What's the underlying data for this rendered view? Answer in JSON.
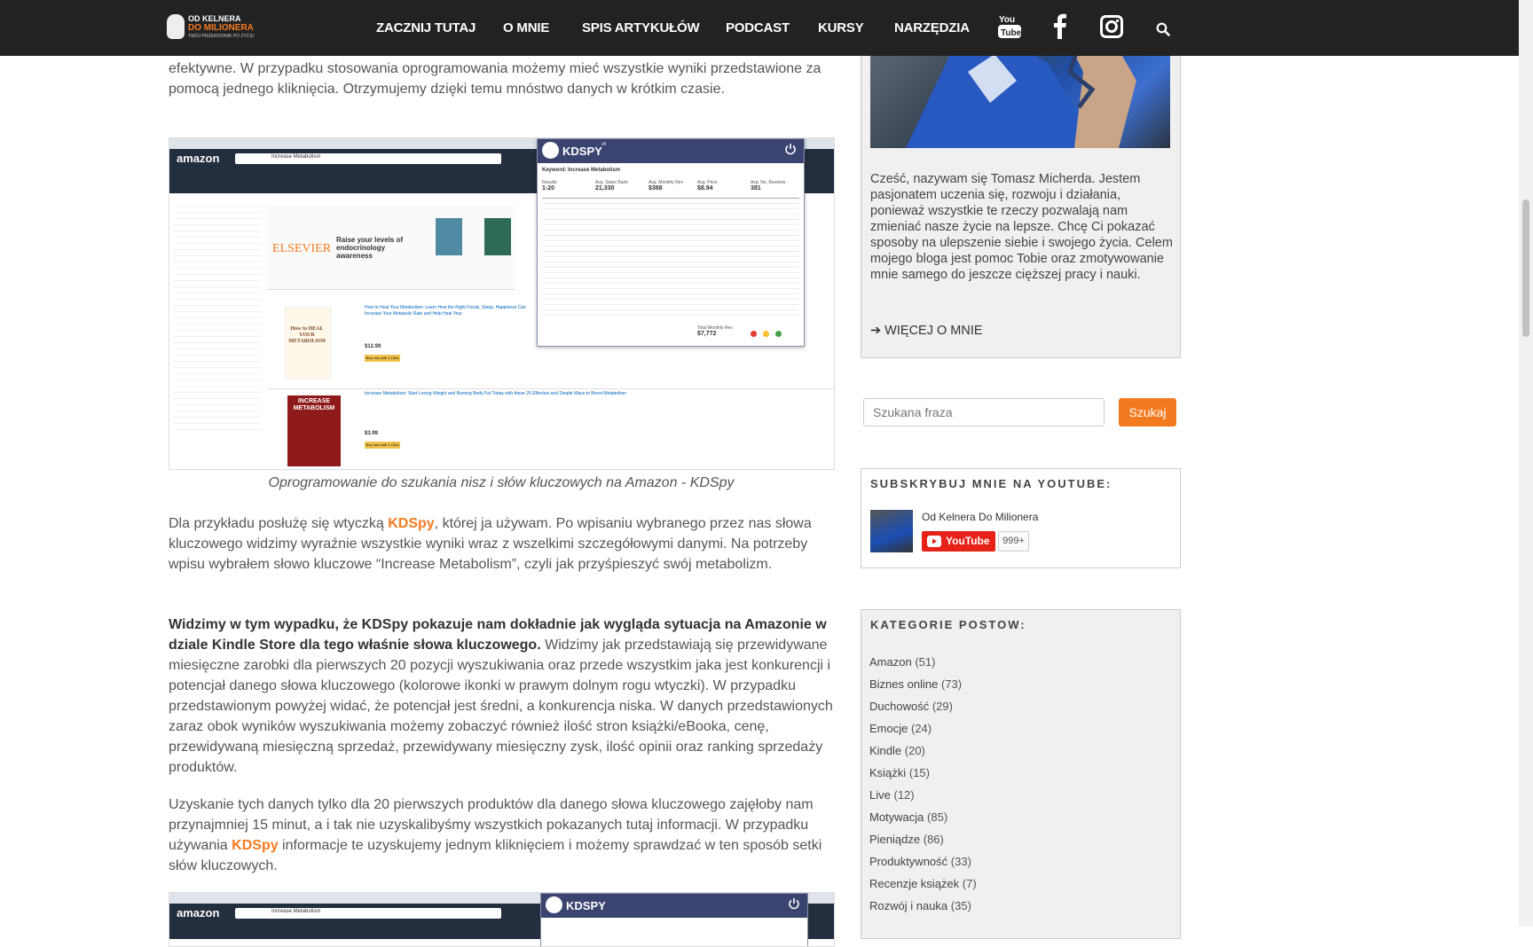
{
  "nav": {
    "logo_top": "OD KELNERA",
    "logo_main": "DO MILIONERA",
    "logo_sub": "TWÓJ PRZEWODNIK PO ŻYCIU",
    "items": [
      "ZACZNIJ TUTAJ",
      "O MNIE",
      "SPIS ARTYKUŁÓW",
      "PODCAST",
      "KURSY",
      "NARZĘDZIA"
    ],
    "icons": [
      "youtube-icon",
      "facebook-icon",
      "instagram-icon",
      "search-icon"
    ]
  },
  "article": {
    "p0": "efektywne. W przypadku stosowania oprogramowania możemy mieć wszystkie wyniki przedstawione za pomocą jednego kliknięcia. Otrzymujemy dzięki temu mnóstwo danych w krótkim czasie.",
    "caption": "Oprogramowanie do szukania nisz i słów kluczowych na Amazon - KDSpy",
    "p1_pre": "Dla przykładu posłużę się wtyczką ",
    "p1_link": "KDSpy",
    "p1_post": ", której ja używam. Po wpisaniu wybranego przez nas słowa kluczowego widzimy wyraźnie wszystkie wyniki wraz z wszelkimi szczegółowymi danymi. Na potrzeby wpisu wybrałem słowo kluczowe “Increase Metabolism”, czyli jak przyśpieszyć swój metabolizm.",
    "p2_bold": "Widzimy w tym wypadku, że KDSpy pokazuje nam dokładnie jak wygląda sytuacja na Amazonie w dziale Kindle Store dla tego właśnie słowa kluczowego.",
    "p2_rest": " Widzimy jak przedstawiają się przewidywane miesięczne zarobki dla pierwszych 20 pozycji wyszukiwania oraz przede wszystkim jaka jest konkurencji i potencjał danego słowa kluczowego (kolorowe ikonki w prawym dolnym rogu wtyczki). W przypadku przedstawionym powyżej widać, że potencjał jest średni, a konkurencja niska. W danych przedstawionych zaraz obok wyników wyszukiwania możemy zobaczyć również ilość stron książki/eBooka, cenę, przewidywaną miesięczną sprzedaż, przewidywany miesięczny zysk, ilość opinii oraz ranking sprzedaży produktów.",
    "p3_pre": "Uzyskanie tych danych tylko dla 20 pierwszych produktów dla danego słowa kluczowego zajęłoby nam przynajmniej 15 minut, a i tak nie uzyskalibyśmy wszystkich pokazanych tutaj informacji. W przypadku używania ",
    "p3_link": "KDSpy",
    "p3_post": " informacje te uzyskujemy jednym kliknięciem i możemy sprawdzać w ten sposób setki słów kluczowych."
  },
  "screenshot": {
    "amazon_logo": "amazon",
    "search_text": "Increase Metabolism",
    "kdspy_title": "KDSPY",
    "kdspy_version": "v5",
    "keyword_label": "Keyword: Increase Metabolism",
    "stats": [
      {
        "label": "Results",
        "value": "1-20"
      },
      {
        "label": "Avg. Sales Rank",
        "value": "21,330"
      },
      {
        "label": "Avg. Monthly Rev",
        "value": "$388"
      },
      {
        "label": "Avg. Price",
        "value": "$8.94"
      },
      {
        "label": "Avg. No. Reviews",
        "value": "381"
      }
    ],
    "total_rev_label": "Total Monthly Rev",
    "total_rev": "$7,772",
    "elsevier": "ELSEVIER",
    "elsevier_ad": "Raise your levels of endocrinology awareness",
    "book1_cover": "How to HEAL YOUR METABOLISM",
    "book1_title": "How to Heal Your Metabolism: Learn How the Right Foods, Sleep, Happiness Can Increase Your Metabolic Rate and Help Heal Your",
    "book1_price": "$12.99",
    "book2_cover": "INCREASE METABOLISM",
    "book2_title": "Increase Metabolism: Start Losing Weight and Burning Body Fat Today with these 25 Effective and Simple Ways to Boost Metabolism",
    "book2_price": "$3.99",
    "buy_button": "Buy now with 1-Click"
  },
  "sidebar": {
    "bio": "Cześć, nazywam się Tomasz Micherda. Jestem pasjonatem uczenia się, rozwoju i działania, ponieważ wszystkie te rzeczy pozwalają nam zmieniać nasze życie na lepsze. Chcę Ci pokazać sposoby na ulepszenie siebie i swojego życia. Celem mojego bloga jest pomoc Tobie oraz zmotywowanie mnie samego do jeszcze cięższej pracy i nauki.",
    "more_link": "➔ WIĘCEJ O MNIE",
    "search_placeholder": "Szukana fraza",
    "search_button": "Szukaj",
    "youtube_heading": "SUBSKRYBUJ MNIE NA YOUTUBE:",
    "channel_name": "Od Kelnera Do Milionera",
    "youtube_button": "YouTube",
    "subscriber_count": "999+",
    "categories_heading": "KATEGORIE POSTOW:",
    "categories": [
      {
        "name": "Amazon",
        "count": "(51)"
      },
      {
        "name": "Biznes online",
        "count": "(73)"
      },
      {
        "name": "Duchowość",
        "count": "(29)"
      },
      {
        "name": "Emocje",
        "count": "(24)"
      },
      {
        "name": "Kindle",
        "count": "(20)"
      },
      {
        "name": "Książki",
        "count": "(15)"
      },
      {
        "name": "Live",
        "count": "(12)"
      },
      {
        "name": "Motywacja",
        "count": "(85)"
      },
      {
        "name": "Pieniądze",
        "count": "(86)"
      },
      {
        "name": "Produktywność",
        "count": "(33)"
      },
      {
        "name": "Recenzje książek",
        "count": "(7)"
      },
      {
        "name": "Rozwój i nauka",
        "count": "(35)"
      }
    ]
  },
  "colors": {
    "accent": "#f47a20",
    "nav_bg": "#222222",
    "youtube_red": "#e62117"
  }
}
